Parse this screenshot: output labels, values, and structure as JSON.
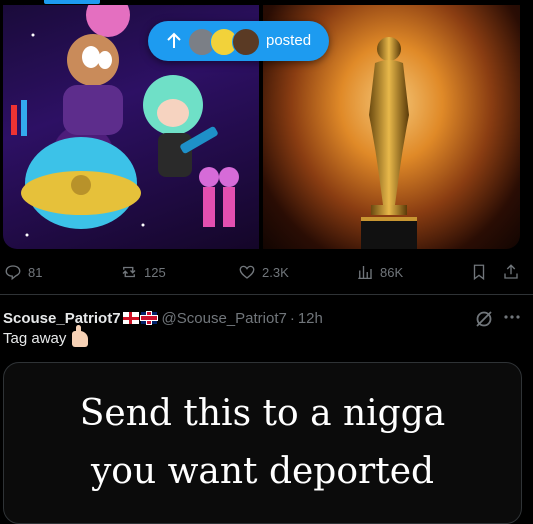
{
  "toast": {
    "label": "posted",
    "icon": "arrow-up-icon",
    "color": "#1d9bf0"
  },
  "previous_tweet": {
    "stats": {
      "replies": "81",
      "reposts": "125",
      "likes": "2.3K",
      "views": "86K"
    }
  },
  "tweet": {
    "display_name": "Scouse_Patriot7",
    "handle": "@Scouse_Patriot7",
    "separator": "·",
    "time": "12h",
    "text": "Tag away",
    "image_text": {
      "line1": "Send this to a nigga",
      "line2": "you want deported"
    }
  },
  "colors": {
    "background": "#000000",
    "accent": "#1d9bf0",
    "text_primary": "#e7e9ea",
    "text_secondary": "#71767b",
    "divider": "#2f3336"
  }
}
